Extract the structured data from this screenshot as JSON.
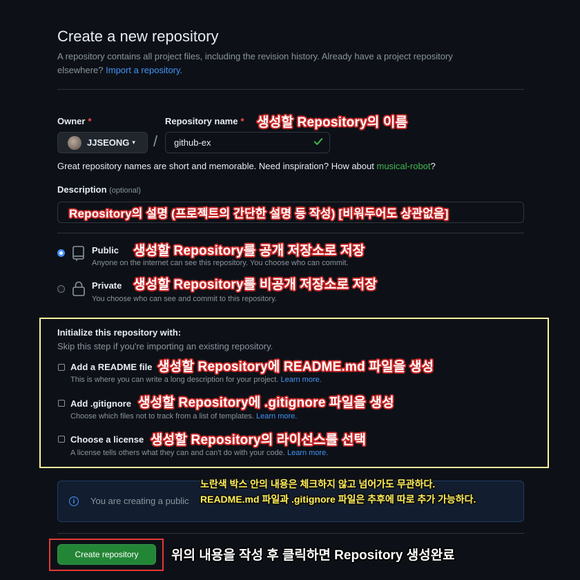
{
  "header": {
    "title": "Create a new repository",
    "intro": "A repository contains all project files, including the revision history. Already have a project repository elsewhere?",
    "import_link": "Import a repository."
  },
  "owner": {
    "label": "Owner",
    "required": "*",
    "value": "JJSEONG",
    "caret": "▾"
  },
  "repo_name": {
    "label": "Repository name",
    "required": "*",
    "value": "github-ex",
    "separator": "/"
  },
  "hint": {
    "text": "Great repository names are short and memorable. Need inspiration? How about",
    "suggestion": "musical-robot",
    "end": "?"
  },
  "description": {
    "label": "Description",
    "optional": "(optional)"
  },
  "visibility": {
    "public": {
      "title": "Public",
      "sub": "Anyone on the internet can see this repository. You choose who can commit.",
      "selected": true
    },
    "private": {
      "title": "Private",
      "sub": "You choose who can see and commit to this repository.",
      "selected": false
    }
  },
  "init": {
    "title": "Initialize this repository with:",
    "sub": "Skip this step if you're importing an existing repository.",
    "items": [
      {
        "title": "Add a README file",
        "sub": "This is where you can write a long description for your project.",
        "link": "Learn more."
      },
      {
        "title": "Add .gitignore",
        "sub": "Choose which files not to track from a list of templates.",
        "link": "Learn more."
      },
      {
        "title": "Choose a license",
        "sub": "A license tells others what they can and can't do with your code.",
        "link": "Learn more."
      }
    ]
  },
  "info": {
    "text": "You are creating a public"
  },
  "create_button": "Create repository",
  "annotations": {
    "repo_name": "생성할 Repository의 이름",
    "description": "Repository의 설명 (프로젝트의 간단한 설명 등 작성) [비워두어도 상관없음]",
    "public": "생성할 Repository를 공개 저장소로 저장",
    "private": "생성할 Repository를 비공개 저장소로 저장",
    "readme": "생성할 Repository에 README.md 파일을 생성",
    "gitignore": "생성할 Repository에 .gitignore 파일을 생성",
    "license": "생성할 Repository의 라이선스를 선택",
    "yellow_note_1": "노란색 박스 안의 내용은 체크하지 않고 넘어가도 무관하다.",
    "yellow_note_2": "README.md 파일과 .gitignore 파일은 추후에 따로 추가 가능하다.",
    "create": "위의 내용을 작성 후 클릭하면 Repository 생성완료"
  },
  "colors": {
    "accent": "#4493f8",
    "success": "#3fb950",
    "button": "#238636",
    "highlight_box": "#fff59d",
    "button_box": "#e53935"
  }
}
